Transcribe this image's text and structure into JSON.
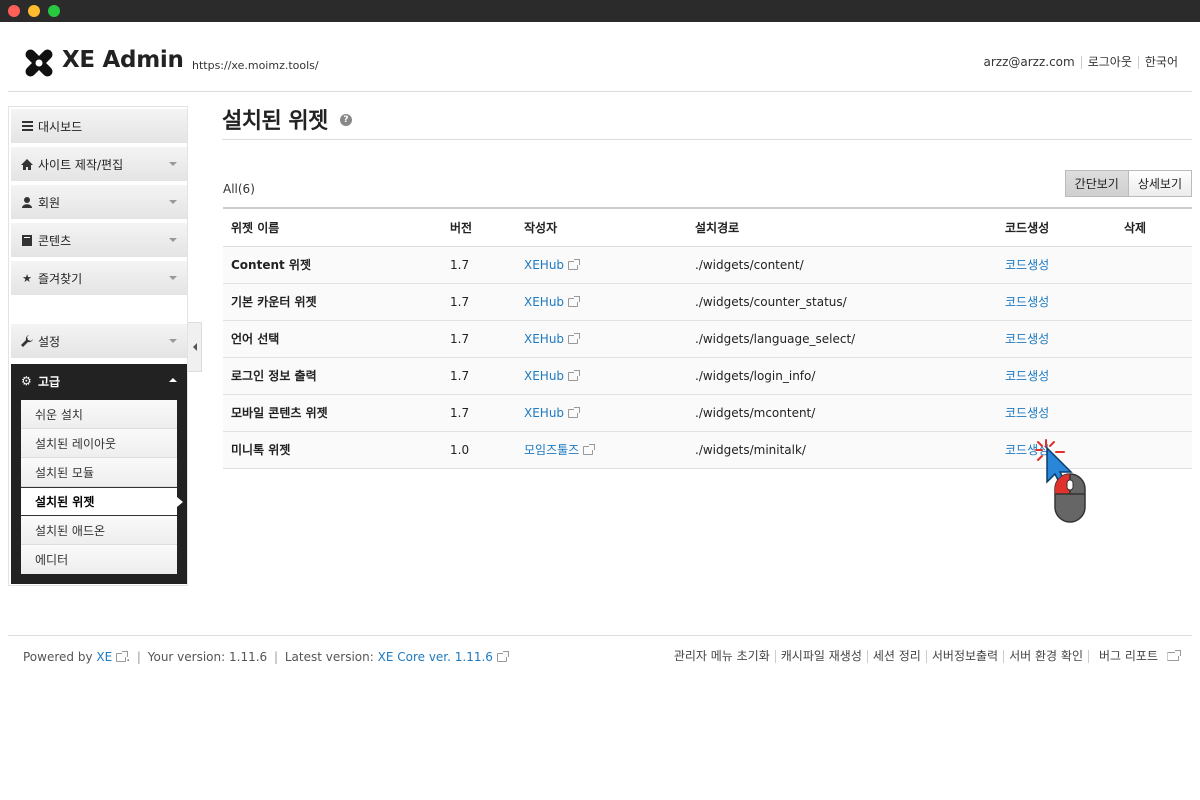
{
  "header": {
    "logo_text": "XE Admin",
    "site_url": "https://xe.moimz.tools/",
    "gnb": [
      "arzz@arzz.com",
      "로그아웃",
      "한국어"
    ]
  },
  "sidebar": {
    "items": [
      {
        "label": "대시보드",
        "icon": "list-icon"
      },
      {
        "label": "사이트 제작/편집",
        "icon": "home-icon"
      },
      {
        "label": "회원",
        "icon": "user-icon"
      },
      {
        "label": "콘텐츠",
        "icon": "book-icon"
      },
      {
        "label": "즐겨찾기",
        "icon": "star-icon"
      },
      {
        "label": "설정",
        "icon": "wrench-icon"
      }
    ],
    "advanced": {
      "label": "고급",
      "icon": "gear-icon",
      "sub_items": [
        "쉬운 설치",
        "설치된 레이아웃",
        "설치된 모듈",
        "설치된 위젯",
        "설치된 애드온",
        "에디터"
      ]
    }
  },
  "main": {
    "title": "설치된 위젯",
    "help_glyph": "?",
    "count_label": "All(6)",
    "view_simple": "간단보기",
    "view_detail": "상세보기",
    "columns": [
      "위젯 이름",
      "버전",
      "작성자",
      "설치경로",
      "코드생성",
      "삭제"
    ],
    "rows": [
      {
        "name": "Content 위젯",
        "version": "1.7",
        "author": "XEHub",
        "path": "./widgets/content/",
        "code": "코드생성"
      },
      {
        "name": "기본 카운터 위젯",
        "version": "1.7",
        "author": "XEHub",
        "path": "./widgets/counter_status/",
        "code": "코드생성"
      },
      {
        "name": "언어 선택",
        "version": "1.7",
        "author": "XEHub",
        "path": "./widgets/language_select/",
        "code": "코드생성"
      },
      {
        "name": "로그인 정보 출력",
        "version": "1.7",
        "author": "XEHub",
        "path": "./widgets/login_info/",
        "code": "코드생성"
      },
      {
        "name": "모바일 콘텐츠 위젯",
        "version": "1.7",
        "author": "XEHub",
        "path": "./widgets/mcontent/",
        "code": "코드생성"
      },
      {
        "name": "미니톡 위젯",
        "version": "1.0",
        "author": "모임즈툴즈",
        "path": "./widgets/minitalk/",
        "code": "코드생성"
      }
    ]
  },
  "footer": {
    "powered_by": "Powered by",
    "xe": "XE",
    "your_version_label": "Your version:",
    "your_version": "1.11.6",
    "latest_version_label": "Latest version:",
    "latest_version": "XE Core ver. 1.11.6",
    "links": [
      "관리자 메뉴 초기화",
      "캐시파일 재생성",
      "세션 정리",
      "서버정보출력",
      "서버 환경 확인",
      "버그 리포트"
    ]
  },
  "colors": {
    "link": "#1d7ac1",
    "sidebar_dark": "#222222"
  }
}
